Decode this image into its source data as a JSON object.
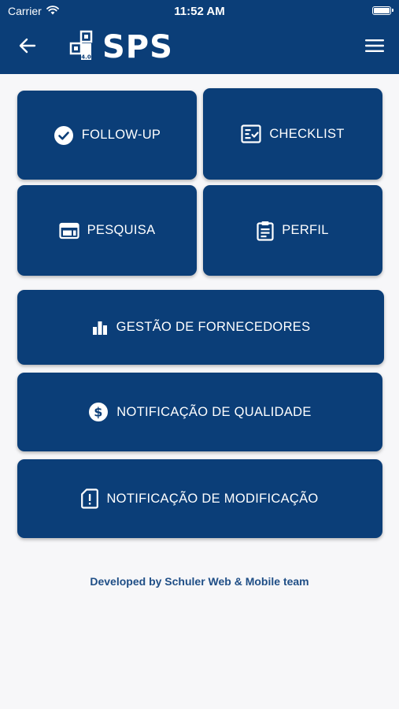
{
  "status_bar": {
    "carrier": "Carrier",
    "time": "11:52 AM"
  },
  "header": {
    "logo_text": "SPS",
    "logo_badge": "4.0",
    "back_icon": "arrow-left-icon",
    "menu_icon": "hamburger-menu-icon"
  },
  "menu": {
    "follow_up": "FOLLOW-UP",
    "checklist": "CHECKLIST",
    "pesquisa": "PESQUISA",
    "perfil": "PERFIL",
    "gestao": "GESTÃO DE FORNECEDORES",
    "notif_qualidade": "NOTIFICAÇÃO DE QUALIDADE",
    "notif_modificacao": "NOTIFICAÇÃO DE MODIFICAÇÃO"
  },
  "footer": {
    "credit": "Developed by Schuler Web & Mobile team"
  },
  "colors": {
    "brand": "#0b3e78",
    "background": "#f7f7f9",
    "footer_text": "#1f4e86"
  }
}
